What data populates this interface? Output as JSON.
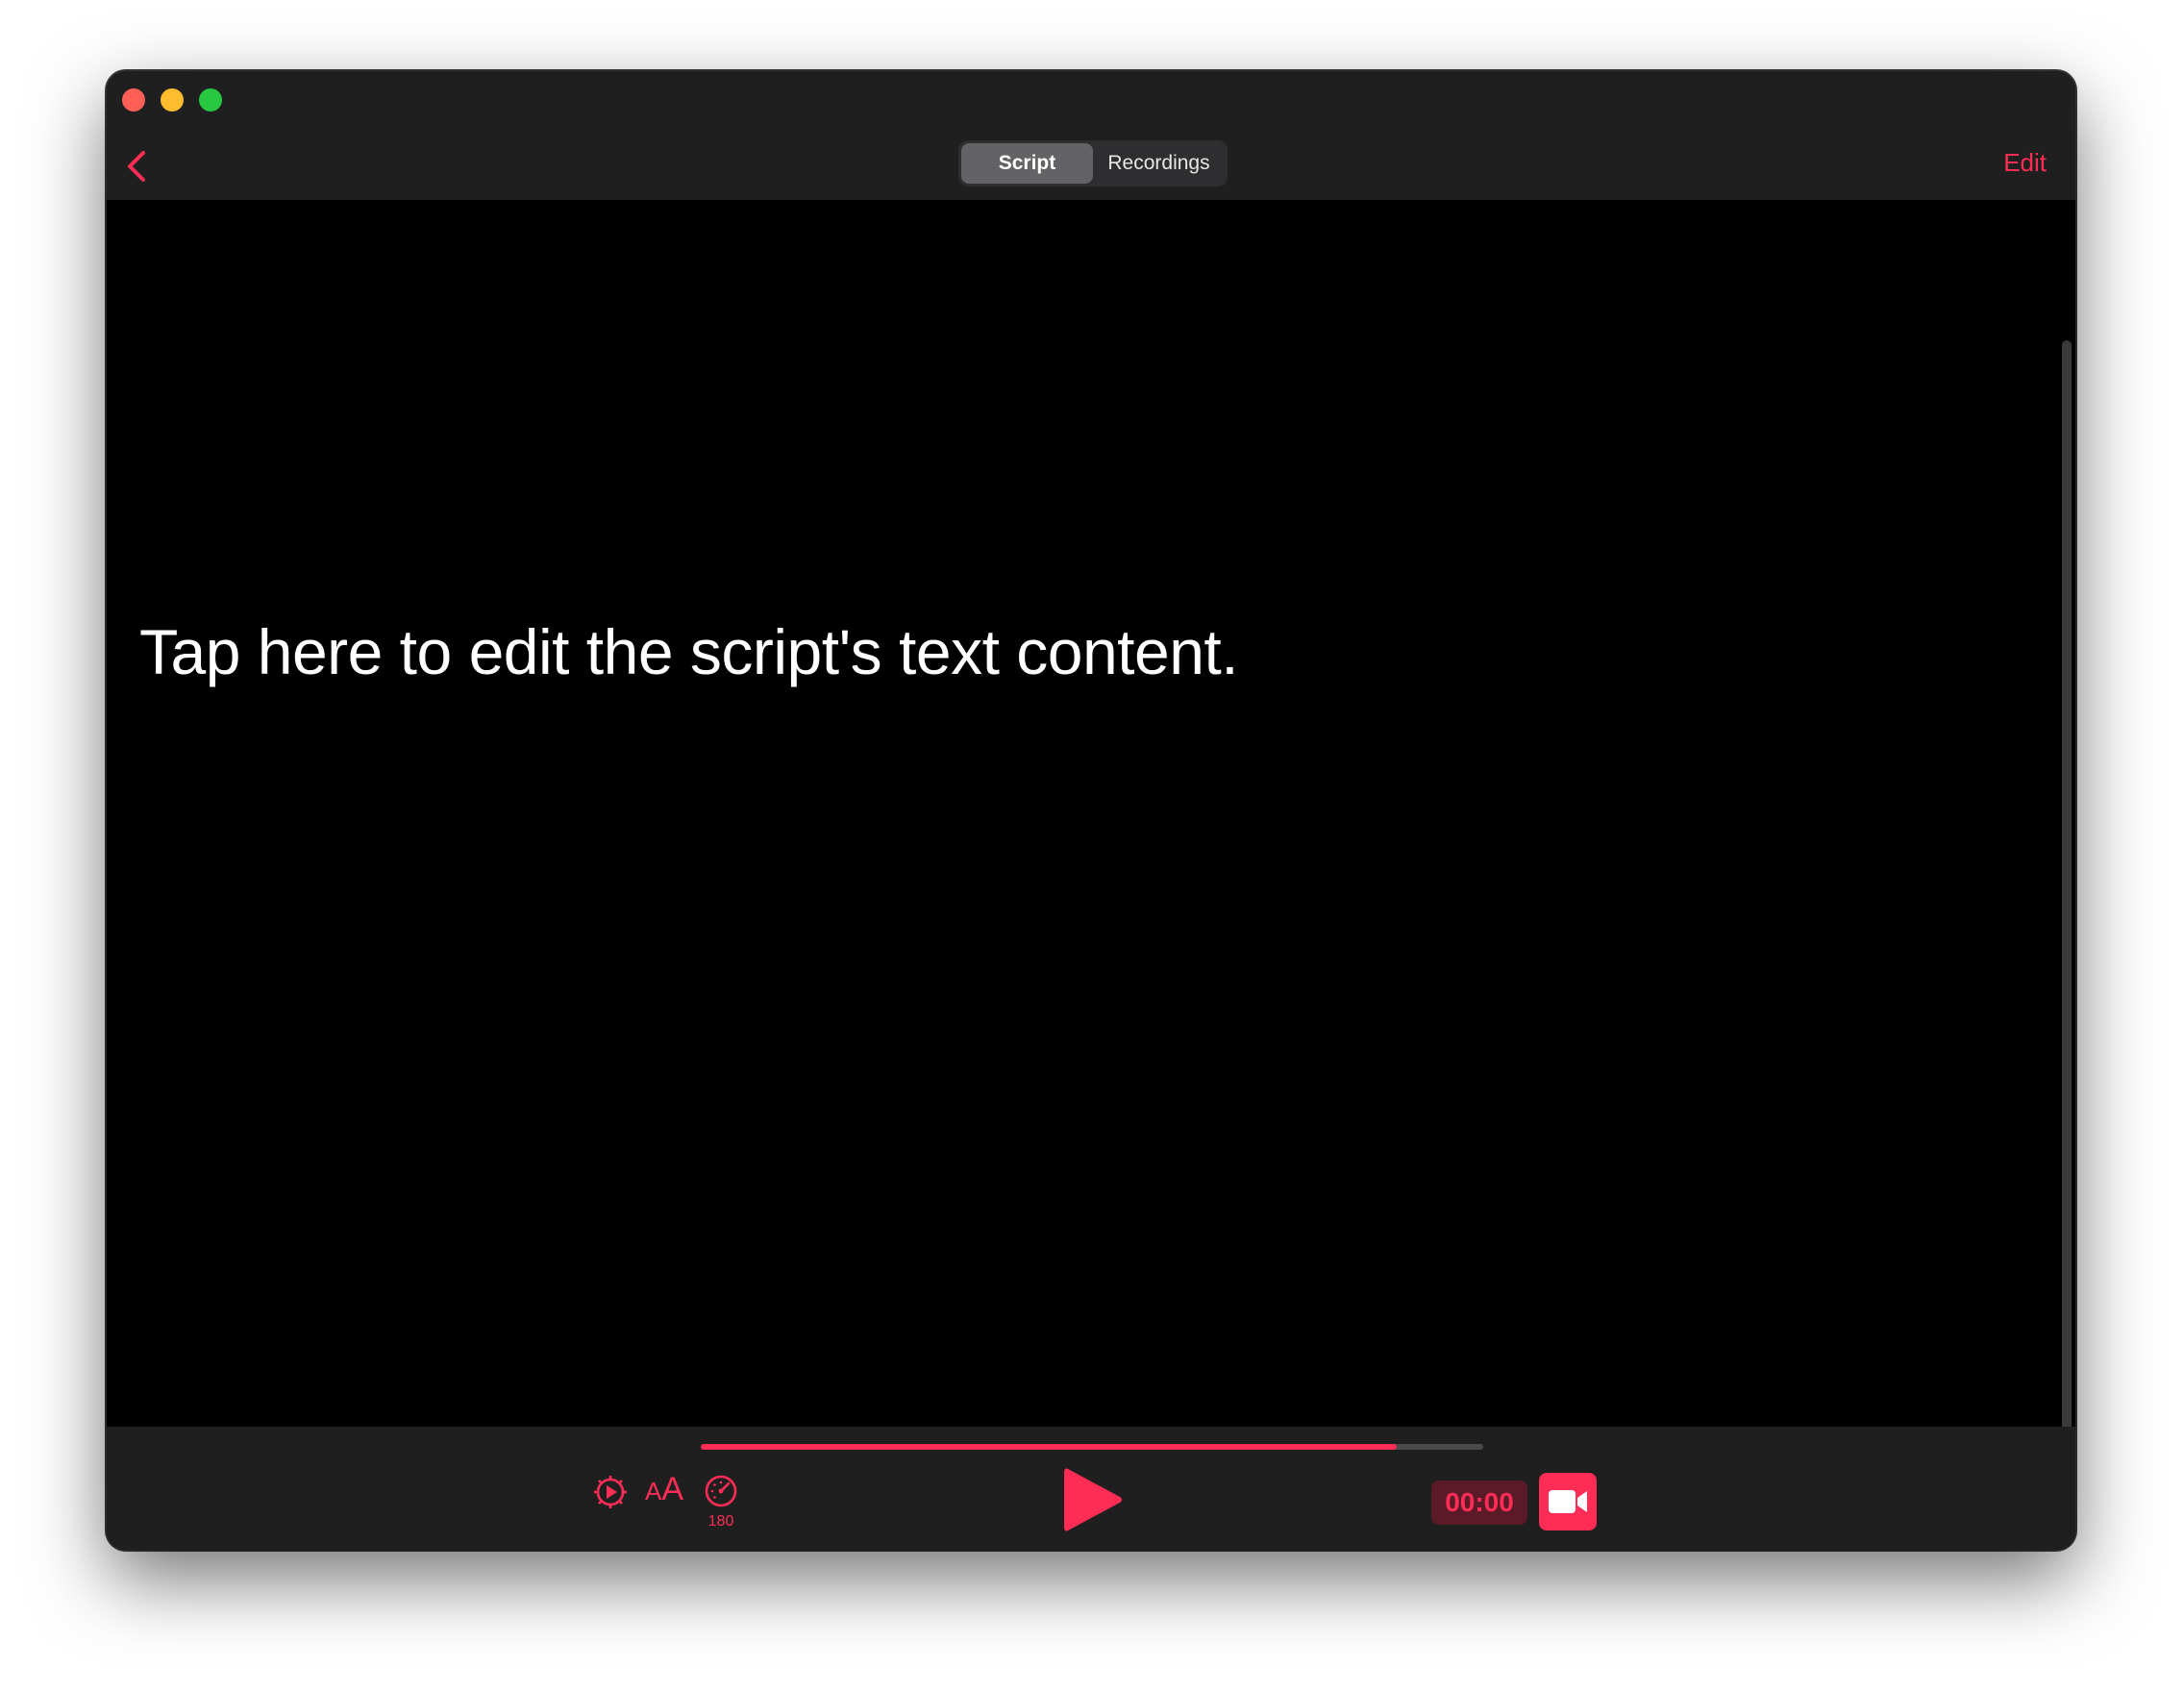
{
  "header": {
    "tabs": [
      {
        "label": "Script",
        "active": true
      },
      {
        "label": "Recordings",
        "active": false
      }
    ],
    "edit_label": "Edit",
    "back_icon": "chevron-left-icon"
  },
  "content": {
    "script_text": "Tap here to edit the script's text content."
  },
  "toolbar": {
    "progress_percent": 89,
    "speed_value": "180",
    "timer": "00:00",
    "icons": [
      "gear-play-icon",
      "font-size-icon",
      "speedometer-icon",
      "play-icon",
      "video-camera-icon"
    ],
    "font_size_small": "A",
    "font_size_big": "A"
  },
  "colors": {
    "accent": "#ff2d55",
    "titlebar": "#1f1f1f",
    "content_bg": "#000000",
    "text": "#ffffff"
  }
}
